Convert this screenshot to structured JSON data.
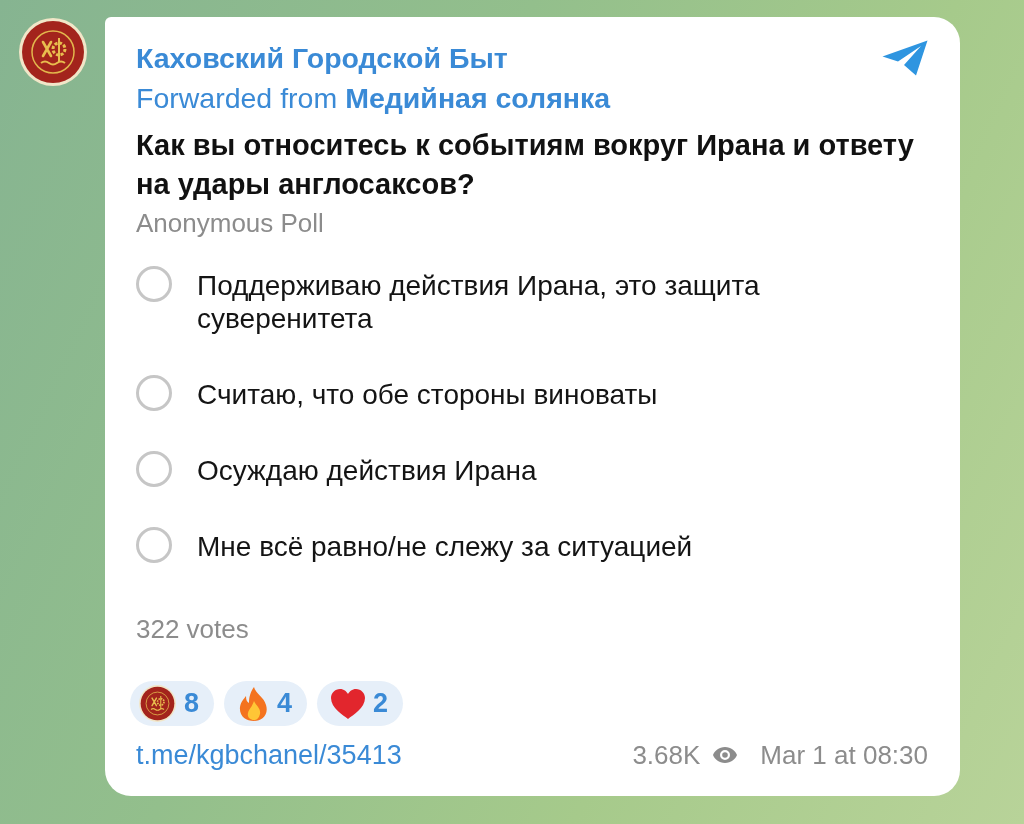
{
  "channel": {
    "name": "Каховский Городской Быт",
    "forwarded_label": "Forwarded from",
    "forwarded_source": "Медийная солянка"
  },
  "poll": {
    "question": "Как вы относитесь к событиям вокруг Ирана и ответу на удары англосаксов?",
    "type": "Anonymous Poll",
    "options": [
      {
        "text": "Поддерживаю действия Ирана, это защита суверенитета",
        "selected": false
      },
      {
        "text": "Считаю, что обе стороны виноваты",
        "selected": false
      },
      {
        "text": "Осуждаю действия Ирана",
        "selected": false
      },
      {
        "text": "Мне всё равно/не слежу за ситуацией",
        "selected": false
      }
    ],
    "votes": "322 votes"
  },
  "reactions": [
    {
      "kind": "channel-logo",
      "count": "8"
    },
    {
      "kind": "fire",
      "count": "4"
    },
    {
      "kind": "heart",
      "count": "2"
    }
  ],
  "footer": {
    "link": "t.me/kgbchanel/35413",
    "views": "3.68K",
    "date": "Mar 1 at 08:30"
  }
}
